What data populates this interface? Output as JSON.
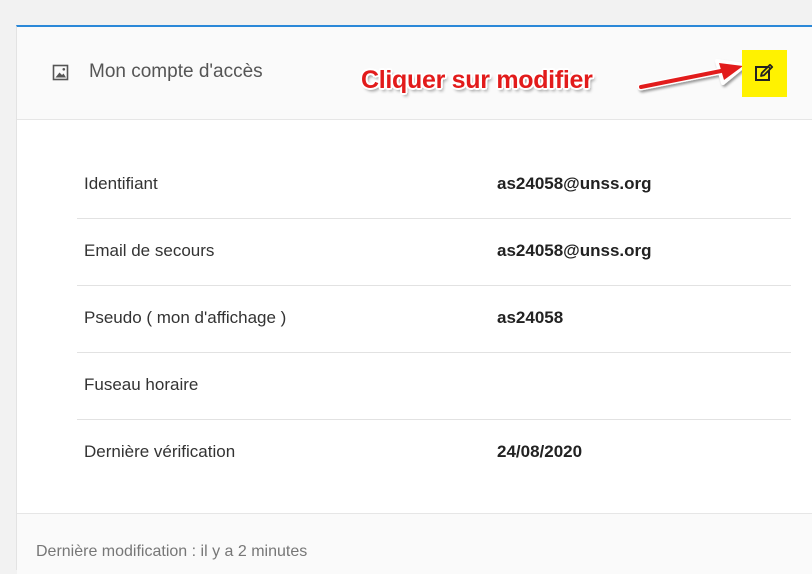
{
  "card": {
    "title": "Mon compte d'accès",
    "title_icon": "image-icon",
    "edit_icon": "edit-icon"
  },
  "annotation": {
    "text": "Cliquer sur modifier",
    "color": "#e21b1b"
  },
  "highlight_color": "#fff200",
  "accent_color": "#2b88d8",
  "rows": [
    {
      "label": "Identifiant",
      "value": "as24058@unss.org"
    },
    {
      "label": "Email de secours",
      "value": "as24058@unss.org"
    },
    {
      "label": "Pseudo ( mon d'affichage )",
      "value": "as24058"
    },
    {
      "label": "Fuseau horaire",
      "value": ""
    },
    {
      "label": "Dernière vérification",
      "value": "24/08/2020"
    }
  ],
  "footer": {
    "text": "Dernière modification : il y a 2 minutes"
  }
}
